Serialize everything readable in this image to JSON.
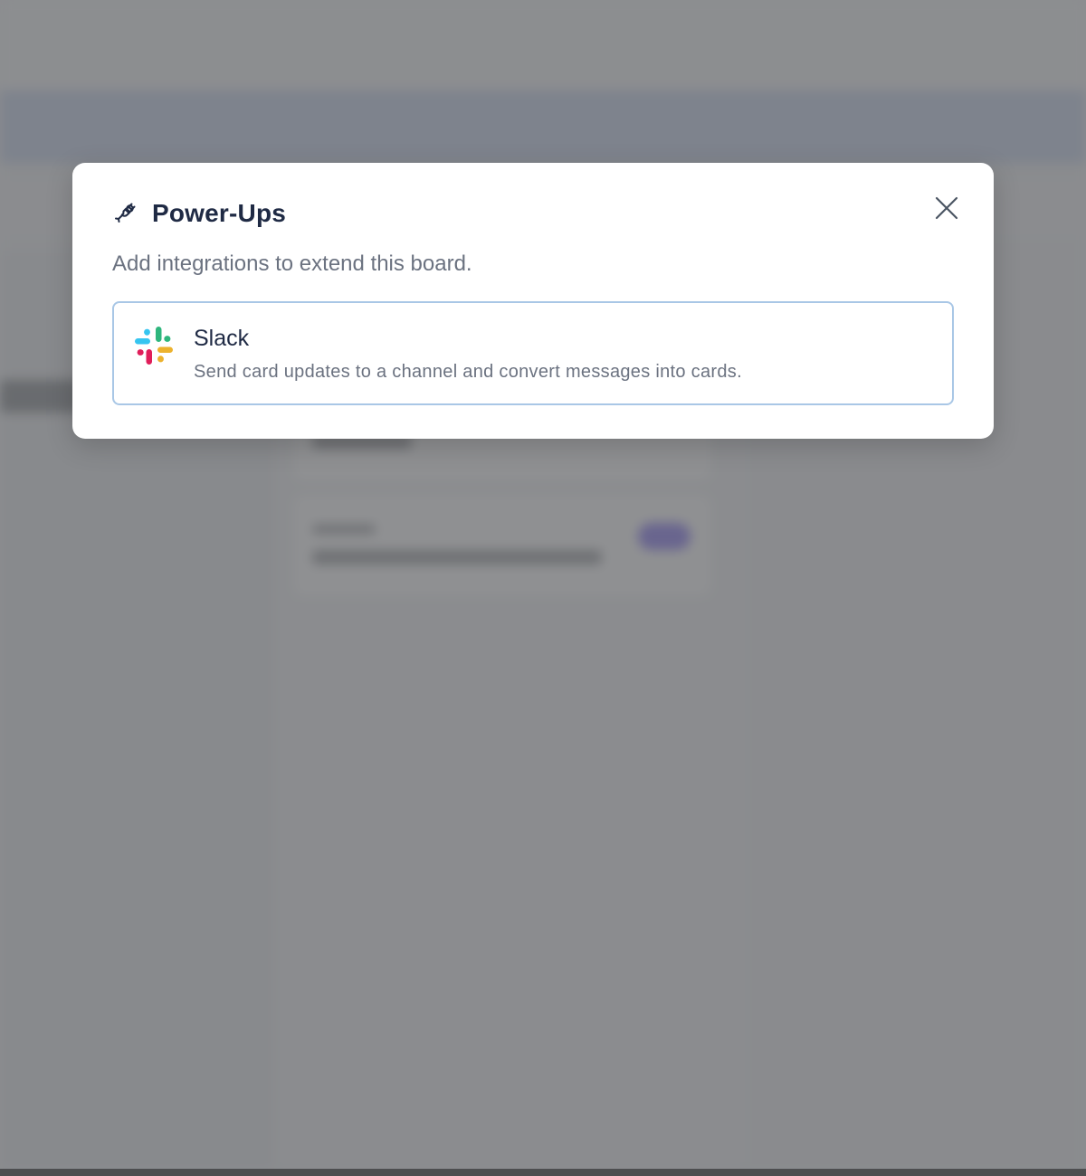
{
  "modal": {
    "title": "Power-Ups",
    "title_icon": "plug-icon",
    "subtitle": "Add integrations to extend this board.",
    "close_icon": "close-icon"
  },
  "integrations": [
    {
      "name": "Slack",
      "icon": "slack-icon",
      "description": "Send card updates to a channel and convert messages into cards."
    }
  ],
  "colors": {
    "title": "#1f2a44",
    "muted_text": "#6b7280",
    "card_border": "#a9c7e6",
    "slack_blue": "#36c5f0",
    "slack_green": "#2eb67d",
    "slack_red": "#e01e5a",
    "slack_yellow": "#ecb22e"
  }
}
